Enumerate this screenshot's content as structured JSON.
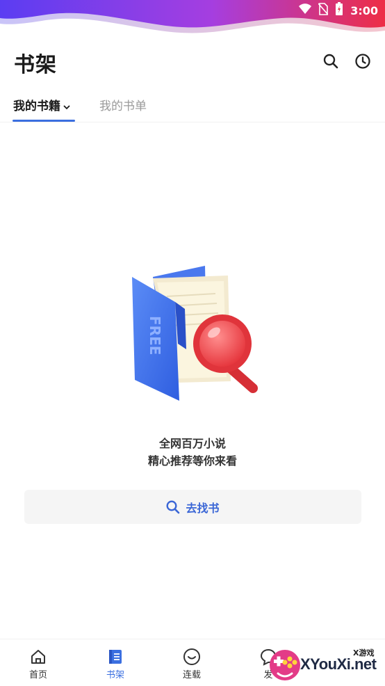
{
  "status_bar": {
    "time": "3:00",
    "icons": [
      "wifi-icon",
      "no-sim-icon",
      "battery-icon"
    ],
    "wave_colors": [
      "#6a3cf0",
      "#b03ad6",
      "#e8304a"
    ]
  },
  "header": {
    "title": "书架",
    "search_icon": "search-icon",
    "history_icon": "clock-icon"
  },
  "tabs": [
    {
      "label": "我的书籍",
      "active": true
    },
    {
      "label": "我的书单",
      "active": false
    }
  ],
  "empty_state": {
    "illustration_text": "FREE",
    "line1": "全网百万小说",
    "line2": "精心推荐等你来看",
    "button_label": "去找书"
  },
  "bottom_nav": [
    {
      "label": "首页",
      "icon": "home-icon",
      "active": false
    },
    {
      "label": "书架",
      "icon": "bookshelf-icon",
      "active": true
    },
    {
      "label": "连载",
      "icon": "smile-face-icon",
      "active": false
    },
    {
      "label": "发",
      "icon": "chat-icon",
      "active": false
    }
  ],
  "watermark": {
    "small": "X游戏",
    "big": "XYouXi.net"
  },
  "colors": {
    "accent": "#3b6fe0",
    "button_text": "#3a66d6",
    "button_bg": "#f5f5f5",
    "inactive_tab": "#9a9a9a"
  }
}
